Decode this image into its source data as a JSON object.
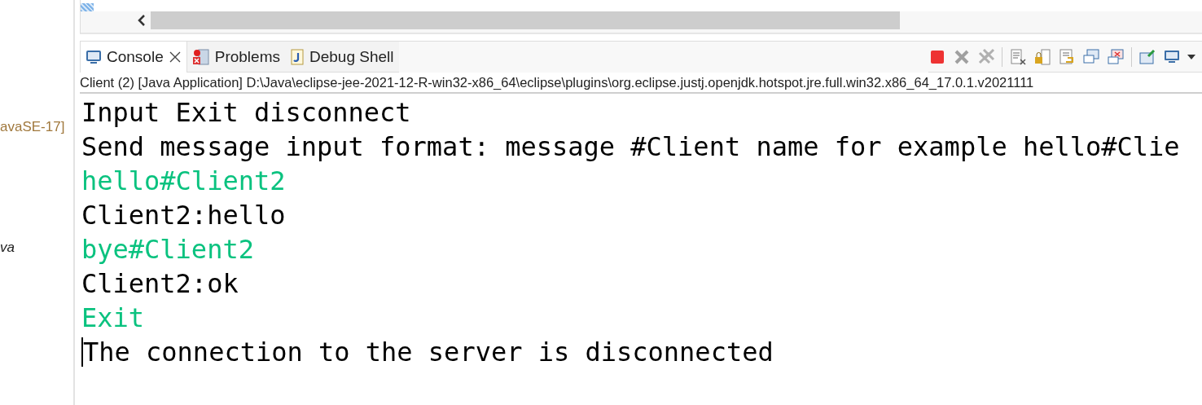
{
  "explorer": {
    "items": [
      {
        "text": "avaSE-17]",
        "kind": "decoration"
      },
      {
        "text": "va",
        "kind": "file"
      }
    ]
  },
  "console_view": {
    "tabs": [
      {
        "label": "Console",
        "selected": true,
        "closable": true,
        "kind": "console"
      },
      {
        "label": "Problems",
        "selected": false,
        "closable": false,
        "kind": "problems"
      },
      {
        "label": "Debug Shell",
        "selected": false,
        "closable": false,
        "kind": "shell"
      }
    ],
    "description": "Client (2) [Java Application] D:\\Java\\eclipse-jee-2021-12-R-win32-x86_64\\eclipse\\plugins\\org.eclipse.justj.openjdk.hotspot.jre.full.win32.x86_64_17.0.1.v2021111",
    "lines": [
      {
        "text": "Input Exit disconnect",
        "kind": "output"
      },
      {
        "text": "Send message input format: message #Client name for example hello#Clie",
        "kind": "output"
      },
      {
        "text": "hello#Client2",
        "kind": "input"
      },
      {
        "text": "Client2:hello",
        "kind": "output"
      },
      {
        "text": "bye#Client2",
        "kind": "input"
      },
      {
        "text": "Client2:ok",
        "kind": "output"
      },
      {
        "text": "Exit",
        "kind": "input"
      },
      {
        "text": "The connection to the server is disconnected",
        "kind": "output",
        "caret": true
      }
    ]
  }
}
